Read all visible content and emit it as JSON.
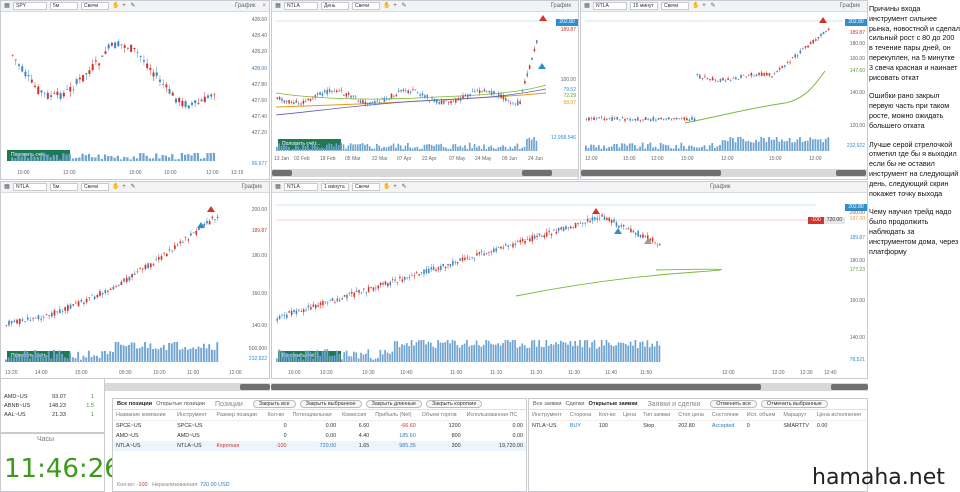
{
  "charts": {
    "c1": {
      "symbol": "SPY",
      "tf": "5м",
      "type": "Свечи",
      "title": "График",
      "prices": [
        "428.60",
        "428.40",
        "428.20",
        "428.00",
        "427.80",
        "427.60",
        "427.40",
        "427.20"
      ],
      "last": "427.90",
      "vol": "66,677",
      "add": "Положить счёт...",
      "times": [
        "10:00",
        "12:00",
        "15:00",
        "10:00",
        "12:00",
        "13:15"
      ]
    },
    "c2": {
      "symbol": "NTLA",
      "tf": "День",
      "type": "Свечи",
      "title": "График",
      "prices": [
        "200.00",
        "100.00",
        "80.00",
        "60.00"
      ],
      "last": "202.80",
      "red": "189.87",
      "green": "72.29",
      "orange": "58.07",
      "blue": "79.52",
      "vol": "12,958,546",
      "add": "Положить счёт...",
      "times": [
        "13 Jan",
        "02 Feb",
        "18 Feb",
        "05 Mar",
        "22 Mar",
        "07 Apr",
        "22 Apr",
        "07 May",
        "24 May",
        "09 Jun",
        "24 Jun"
      ]
    },
    "c3": {
      "symbol": "NTLA",
      "tf": "15 минут",
      "type": "Свечи",
      "title": "График",
      "prices": [
        "200.00",
        "180.00",
        "160.00",
        "140.00",
        "120.00"
      ],
      "last": "202.80",
      "red": "189.87",
      "green": "147.60",
      "vol": "232,922",
      "times": [
        "12:00",
        "15:00",
        "12:00",
        "15:00",
        "12:00",
        "15:00",
        "12:00"
      ]
    },
    "c4": {
      "symbol": "NTLA",
      "tf": "5м",
      "type": "Свечи",
      "title": "График",
      "prices": [
        "200.00",
        "180.00",
        "160.00",
        "140.00"
      ],
      "red": "189.87",
      "vol": "500,000",
      "volval": "232,922",
      "add": "Положить счёт...",
      "times": [
        "13:20",
        "14:00",
        "15:00",
        "09:30",
        "10:20",
        "11:00",
        "12:00"
      ]
    },
    "c5": {
      "symbol": "NTLA",
      "tf": "1 минута",
      "type": "Свечи",
      "title": "График",
      "prices": [
        "200.00",
        "180.00",
        "160.00",
        "140.00"
      ],
      "last": "202.80",
      "blue": "189.87",
      "green": "177.23",
      "orange": "197.00",
      "order": "-100",
      "order2": "720.00",
      "vol": "78,521",
      "add": "Положить счёт...",
      "times": [
        "10:00",
        "10:20",
        "10:30",
        "10:40",
        "11:00",
        "11:10",
        "11:20",
        "11:30",
        "11:40",
        "11:50",
        "12:00",
        "12:20",
        "12:30",
        "12:40"
      ]
    }
  },
  "side": {
    "p1": "Причины входа инструмент сильнее рынка, новостной и сделал сильный рост с 80 до 200 в течение пары дней, он перекуплен, на 5 минутке 3 свеча красная и наинает рисовать откат",
    "p2": "Ошибки рано закрыл первую часть при таком росте, можно ожидать большего отката",
    "p3": "Лучше серой стрелочкой отметил где бы я выходил если бы не оставил инструмент на следующий день, следующий скрин покажет точку выхода",
    "p4": "Чему научил трейд надо было продолжить наблюдать за инструментом дома, через платформу"
  },
  "quotes": [
    {
      "s": "AMD~US",
      "v": "93.07",
      "c": "1"
    },
    {
      "s": "ABNB~US",
      "v": "148.23",
      "c": "1.5"
    },
    {
      "s": "AAL~US",
      "v": "21.33",
      "c": "1"
    }
  ],
  "clock": {
    "title": "Часы",
    "time": "11:46:26"
  },
  "positions": {
    "tab1": "Все позиции",
    "tab2": "Открытые позиции",
    "title": "Позиции",
    "btns": [
      "Закрыть все",
      "Закрыть выбранное",
      "Закрыть длинные",
      "Закрыть короткие"
    ],
    "headers": [
      "Название компании",
      "Инструмент",
      "Размер позиции",
      "Кол-во",
      "Потенциальная",
      "Комиссия",
      "Прибыль (Net)",
      "Объем торгов",
      "Использованная ПС"
    ],
    "rows": [
      [
        "SPCE~US",
        "SPCE~US",
        "",
        "0",
        "0.00",
        "6.60",
        "-66.60",
        "1200",
        "0.00"
      ],
      [
        "AMD~US",
        "AMD~US",
        "",
        "0",
        "0.00",
        "4.40",
        "185.60",
        "800",
        "0.00"
      ],
      [
        "NTLA~US",
        "NTLA~US",
        "Короткая",
        "-100",
        "720.00",
        "1.65",
        "985.35",
        "300",
        "19,720.00"
      ]
    ],
    "foot_label": "Кол-во:",
    "foot_qty": "-100",
    "foot_unr": "Нереализованная:",
    "foot_val": "720.00 USD"
  },
  "orders": {
    "tab1": "Все заявки",
    "tab2": "Сделки",
    "tab3": "Открытые заявки",
    "title": "Заявки и сделки",
    "btns": [
      "Отменить все",
      "Отменить выбранные"
    ],
    "headers": [
      "Инструмент",
      "Сторона",
      "Кол-во",
      "Цена",
      "Тип заявки",
      "Стоп цена",
      "Состояние",
      "Исп. объем",
      "Маршрут",
      "Цена исполнения"
    ],
    "row": [
      "NTLA~US",
      "BUY",
      "100",
      "",
      "Stop",
      "202.80",
      "Accepted",
      "0",
      "SMARTTV",
      "0.00"
    ]
  },
  "watermark": "hamaha.net"
}
